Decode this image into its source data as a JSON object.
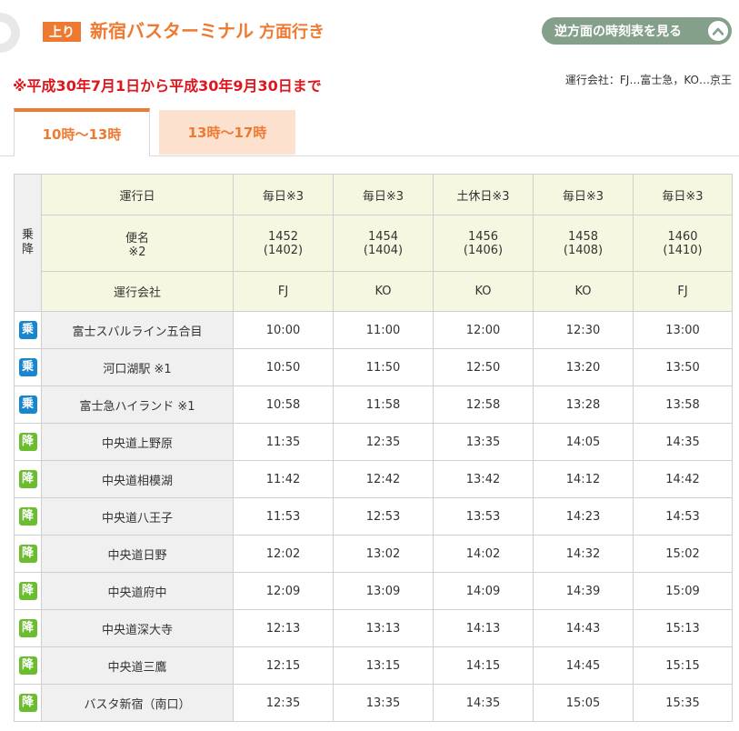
{
  "header": {
    "direction_badge": "上り",
    "title": "新宿バスターミナル",
    "title_suffix": "方面行き",
    "reverse_button": "逆方面の時刻表を見る"
  },
  "notice": "※平成30年7月1日から平成30年9月30日まで",
  "operators": "運行会社：FJ…富士急，KO…京王",
  "tabs": [
    {
      "label": "10時～13時",
      "active": true
    },
    {
      "label": "13時～17時",
      "active": false
    }
  ],
  "table": {
    "board_alight_header": "乗降",
    "row_labels": {
      "days": "運行日",
      "service": "便名",
      "service_note": "※2",
      "company": "運行会社"
    },
    "columns": [
      {
        "days": "毎日※3",
        "service": "1452",
        "alt": "(1402)",
        "company": "FJ"
      },
      {
        "days": "毎日※3",
        "service": "1454",
        "alt": "(1404)",
        "company": "KO"
      },
      {
        "days": "土休日※3",
        "service": "1456",
        "alt": "(1406)",
        "company": "KO"
      },
      {
        "days": "毎日※3",
        "service": "1458",
        "alt": "(1408)",
        "company": "KO"
      },
      {
        "days": "毎日※3",
        "service": "1460",
        "alt": "(1410)",
        "company": "FJ"
      }
    ],
    "stops": [
      {
        "type": "乗",
        "name": "富士スバルライン五合目",
        "times": [
          "10:00",
          "11:00",
          "12:00",
          "12:30",
          "13:00"
        ]
      },
      {
        "type": "乗",
        "name": "河口湖駅 ※1",
        "times": [
          "10:50",
          "11:50",
          "12:50",
          "13:20",
          "13:50"
        ]
      },
      {
        "type": "乗",
        "name": "富士急ハイランド ※1",
        "times": [
          "10:58",
          "11:58",
          "12:58",
          "13:28",
          "13:58"
        ]
      },
      {
        "type": "降",
        "name": "中央道上野原",
        "times": [
          "11:35",
          "12:35",
          "13:35",
          "14:05",
          "14:35"
        ]
      },
      {
        "type": "降",
        "name": "中央道相模湖",
        "times": [
          "11:42",
          "12:42",
          "13:42",
          "14:12",
          "14:42"
        ]
      },
      {
        "type": "降",
        "name": "中央道八王子",
        "times": [
          "11:53",
          "12:53",
          "13:53",
          "14:23",
          "14:53"
        ]
      },
      {
        "type": "降",
        "name": "中央道日野",
        "times": [
          "12:02",
          "13:02",
          "14:02",
          "14:32",
          "15:02"
        ]
      },
      {
        "type": "降",
        "name": "中央道府中",
        "times": [
          "12:09",
          "13:09",
          "14:09",
          "14:39",
          "15:09"
        ]
      },
      {
        "type": "降",
        "name": "中央道深大寺",
        "times": [
          "12:13",
          "13:13",
          "14:13",
          "14:43",
          "15:13"
        ]
      },
      {
        "type": "降",
        "name": "中央道三鷹",
        "times": [
          "12:15",
          "13:15",
          "14:15",
          "14:45",
          "15:15"
        ]
      },
      {
        "type": "降",
        "name": "バスタ新宿（南口）",
        "times": [
          "12:35",
          "13:35",
          "14:35",
          "15:05",
          "15:35"
        ]
      }
    ]
  },
  "colors": {
    "accent": "#ee7a32",
    "notice": "#e0161e",
    "reverse_button": "#85a08a",
    "board_icon": "#1a85cf",
    "alight_icon": "#6bbd30",
    "header_cell": "#f6f7e0",
    "inactive_tab": "#fce1cf"
  },
  "icons": {
    "reverse_button": "chevron-up-icon",
    "board": "board-icon",
    "alight": "alight-icon"
  }
}
